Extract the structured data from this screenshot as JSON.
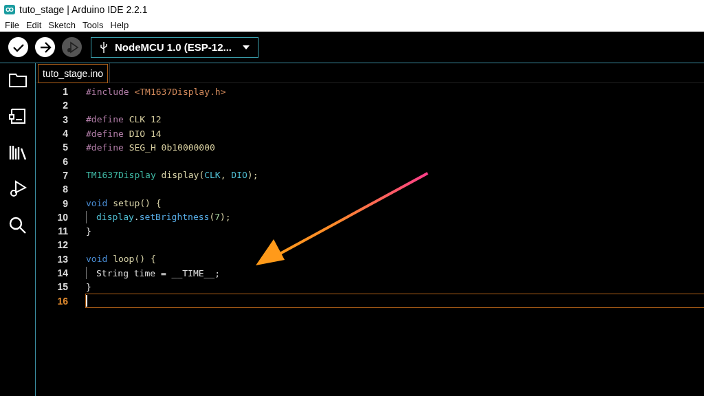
{
  "window": {
    "title": "tuto_stage | Arduino IDE 2.2.1"
  },
  "menu": [
    "File",
    "Edit",
    "Sketch",
    "Tools",
    "Help"
  ],
  "toolbar": {
    "buttons": [
      {
        "kind": "verify",
        "disabled": false
      },
      {
        "kind": "upload",
        "disabled": false
      },
      {
        "kind": "debug",
        "disabled": true
      }
    ],
    "board": "NodeMCU 1.0 (ESP-12..."
  },
  "sidebar": {
    "items": [
      {
        "kind": "folder"
      },
      {
        "kind": "boards"
      },
      {
        "kind": "library"
      },
      {
        "kind": "debug"
      },
      {
        "kind": "search"
      }
    ]
  },
  "tabs": [
    {
      "label": "tuto_stage.ino",
      "selected": true
    }
  ],
  "editor": {
    "lines": [
      {
        "number": "1",
        "current": false,
        "indented": false,
        "tokens": [
          {
            "kind": "preproc",
            "text": "#include "
          },
          {
            "kind": "string",
            "text": "<TM1637Display.h>"
          }
        ]
      },
      {
        "number": "2",
        "current": false,
        "indented": false
      },
      {
        "number": "3",
        "current": false,
        "indented": false,
        "tokens": [
          {
            "kind": "preproc",
            "text": "#define "
          },
          {
            "kind": "macro",
            "text": "CLK 12"
          }
        ]
      },
      {
        "number": "4",
        "current": false,
        "indented": false,
        "tokens": [
          {
            "kind": "preproc",
            "text": "#define "
          },
          {
            "kind": "macro",
            "text": "DIO 14"
          }
        ]
      },
      {
        "number": "5",
        "current": false,
        "indented": false,
        "tokens": [
          {
            "kind": "preproc",
            "text": "#define "
          },
          {
            "kind": "macro",
            "text": "SEG_H 0b10000000"
          }
        ]
      },
      {
        "number": "6",
        "current": false,
        "indented": false
      },
      {
        "number": "7",
        "current": false,
        "indented": false,
        "tokens": [
          {
            "kind": "type",
            "text": "TM1637Display "
          },
          {
            "kind": "func",
            "text": "display("
          },
          {
            "kind": "var",
            "text": "CLK"
          },
          {
            "kind": "func",
            "text": ", "
          },
          {
            "kind": "var",
            "text": "DIO"
          },
          {
            "kind": "func",
            "text": ");"
          }
        ]
      },
      {
        "number": "8",
        "current": false,
        "indented": false
      },
      {
        "number": "9",
        "current": false,
        "indented": false,
        "tokens": [
          {
            "kind": "keyword",
            "text": "void "
          },
          {
            "kind": "func",
            "text": "setup() {"
          }
        ]
      },
      {
        "number": "10",
        "current": false,
        "indented": true,
        "tokens": [
          {
            "kind": "var",
            "text": "display"
          },
          {
            "kind": "plain",
            "text": "."
          },
          {
            "kind": "method",
            "text": "setBrightness"
          },
          {
            "kind": "func",
            "text": "("
          },
          {
            "kind": "number",
            "text": "7"
          },
          {
            "kind": "func",
            "text": ");"
          }
        ]
      },
      {
        "number": "11",
        "current": false,
        "indented": false,
        "tokens": [
          {
            "kind": "plain",
            "text": "}"
          }
        ]
      },
      {
        "number": "12",
        "current": false,
        "indented": false
      },
      {
        "number": "13",
        "current": false,
        "indented": false,
        "tokens": [
          {
            "kind": "keyword",
            "text": "void "
          },
          {
            "kind": "func",
            "text": "loop() {"
          }
        ]
      },
      {
        "number": "14",
        "current": false,
        "indented": true,
        "tokens": [
          {
            "kind": "plain",
            "text": "String time = __TIME__;"
          }
        ]
      },
      {
        "number": "15",
        "current": false,
        "indented": false,
        "tokens": [
          {
            "kind": "plain",
            "text": "}"
          }
        ]
      },
      {
        "number": "16",
        "current": true,
        "indented": false
      }
    ]
  }
}
